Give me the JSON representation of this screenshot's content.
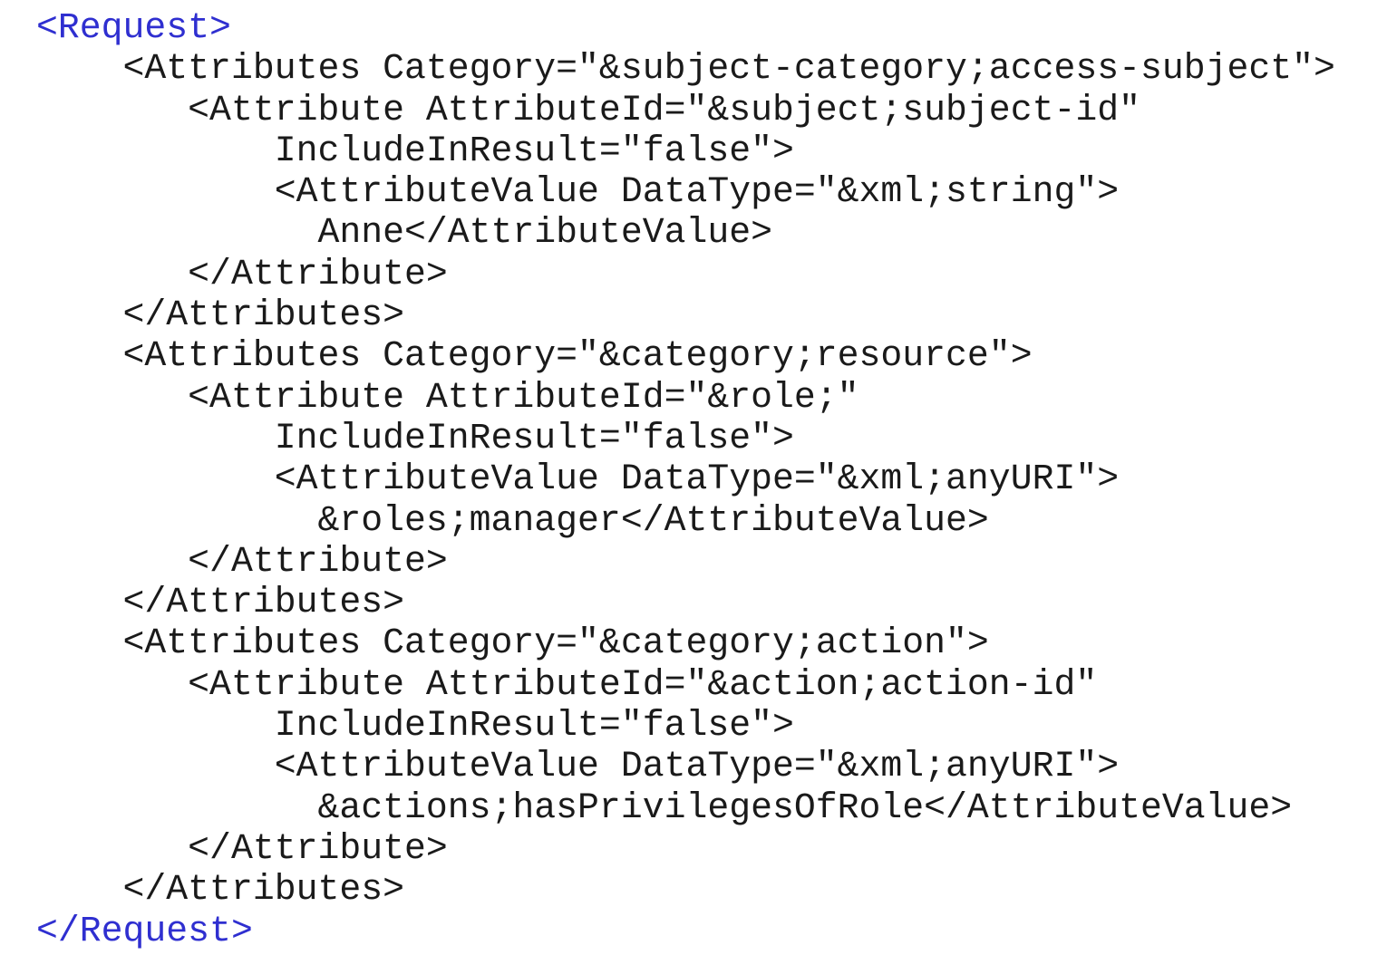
{
  "colors": {
    "text": "#1a1a1a",
    "root_tag": "#2f2fd0",
    "background": "#ffffff"
  },
  "code": {
    "lines": [
      {
        "text": "<Request>",
        "style": "root"
      },
      {
        "text": "    <Attributes Category=\"&subject-category;access-subject\">",
        "style": "default"
      },
      {
        "text": "       <Attribute AttributeId=\"&subject;subject-id\"",
        "style": "default"
      },
      {
        "text": "           IncludeInResult=\"false\">",
        "style": "default"
      },
      {
        "text": "           <AttributeValue DataType=\"&xml;string\">",
        "style": "default"
      },
      {
        "text": "             Anne</AttributeValue>",
        "style": "default"
      },
      {
        "text": "       </Attribute>",
        "style": "default"
      },
      {
        "text": "    </Attributes>",
        "style": "default"
      },
      {
        "text": "    <Attributes Category=\"&category;resource\">",
        "style": "default"
      },
      {
        "text": "       <Attribute AttributeId=\"&role;\"",
        "style": "default"
      },
      {
        "text": "           IncludeInResult=\"false\">",
        "style": "default"
      },
      {
        "text": "           <AttributeValue DataType=\"&xml;anyURI\">",
        "style": "default"
      },
      {
        "text": "             &roles;manager</AttributeValue>",
        "style": "default"
      },
      {
        "text": "       </Attribute>",
        "style": "default"
      },
      {
        "text": "    </Attributes>",
        "style": "default"
      },
      {
        "text": "    <Attributes Category=\"&category;action\">",
        "style": "default"
      },
      {
        "text": "       <Attribute AttributeId=\"&action;action-id\"",
        "style": "default"
      },
      {
        "text": "           IncludeInResult=\"false\">",
        "style": "default"
      },
      {
        "text": "           <AttributeValue DataType=\"&xml;anyURI\">",
        "style": "default"
      },
      {
        "text": "             &actions;hasPrivilegesOfRole</AttributeValue>",
        "style": "default"
      },
      {
        "text": "       </Attribute>",
        "style": "default"
      },
      {
        "text": "    </Attributes>",
        "style": "default"
      },
      {
        "text": "</Request>",
        "style": "root"
      }
    ]
  }
}
